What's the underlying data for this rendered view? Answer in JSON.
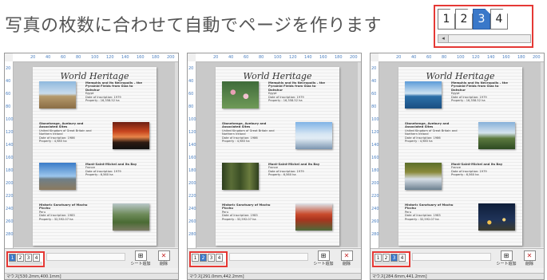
{
  "headline": "写真の枚数に合わせて自動でページを作ります",
  "zoom_tabs": [
    "1",
    "2",
    "3",
    "4"
  ],
  "zoom_selected": "3",
  "ruler_top": [
    "20",
    "40",
    "60",
    "80",
    "100",
    "120",
    "140",
    "160",
    "180",
    "200"
  ],
  "ruler_left": [
    "20",
    "40",
    "60",
    "80",
    "100",
    "120",
    "140",
    "160",
    "180",
    "200",
    "220",
    "240",
    "260",
    "280"
  ],
  "page_title": "World Heritage",
  "panels": [
    {
      "tabs": [
        "1",
        "2",
        "3",
        "4"
      ],
      "entries": [
        {
          "title": "Memphis and its Necropolis – the Pyramid Fields from Giza to Dahshur",
          "lines": [
            "Egypt",
            "Date of Inscription: 1979",
            "Property : 16,358.52 ha"
          ]
        },
        {
          "title": "Stonehenge, Avebury and Associated Sites",
          "lines": [
            "United Kingdom of Great Britain and Northern Ireland",
            "Date of Inscription: 1986",
            "Property : 4,985 ha"
          ]
        },
        {
          "title": "Mont-Saint-Michel and its Bay",
          "lines": [
            "France",
            "Date of Inscription: 1979",
            "Property : 6,560 ha"
          ]
        },
        {
          "title": "Historic Sanctuary of Machu Picchu",
          "lines": [
            "Peru",
            "Date of Inscription: 1983",
            "Property : 32,592.07 ha"
          ]
        }
      ],
      "btn_add": "シート追加",
      "btn_delete": "削除",
      "status": "マウス[530.2mm,400.1mm]"
    },
    {
      "tabs": [
        "1",
        "2",
        "3",
        "4"
      ],
      "entries": [
        {
          "title": "Memphis and its Necropolis – the Pyramid Fields from Giza to Dahshur",
          "lines": [
            "Egypt",
            "Date of Inscription: 1979",
            "Property : 16,358.52 ha"
          ]
        },
        {
          "title": "Stonehenge, Avebury and Associated Sites",
          "lines": [
            "United Kingdom of Great Britain and Northern Ireland",
            "Date of Inscription: 1986",
            "Property : 4,985 ha"
          ]
        },
        {
          "title": "Mont-Saint-Michel and its Bay",
          "lines": [
            "France",
            "Date of Inscription: 1979",
            "Property : 6,560 ha"
          ]
        },
        {
          "title": "Historic Sanctuary of Machu Picchu",
          "lines": [
            "Peru",
            "Date of Inscription: 1983",
            "Property : 32,592.07 ha"
          ]
        }
      ],
      "btn_add": "シート追加",
      "btn_delete": "削除",
      "status": "マウス[291.0mm,442.2mm]"
    },
    {
      "tabs": [
        "1",
        "2",
        "3",
        "4"
      ],
      "entries": [
        {
          "title": "Memphis and its Necropolis – the Pyramid Fields from Giza to Dahshur",
          "lines": [
            "Egypt",
            "Date of Inscription: 1979",
            "Property : 16,358.52 ha"
          ]
        },
        {
          "title": "Stonehenge, Avebury and Associated Sites",
          "lines": [
            "United Kingdom of Great Britain and Northern Ireland",
            "Date of Inscription: 1986",
            "Property : 4,985 ha"
          ]
        },
        {
          "title": "Mont-Saint-Michel and its Bay",
          "lines": [
            "France",
            "Date of Inscription: 1979",
            "Property : 6,560 ha"
          ]
        },
        {
          "title": "Historic Sanctuary of Machu Picchu",
          "lines": [
            "Peru",
            "Date of Inscription: 1983",
            "Property : 32,592.07 ha"
          ]
        }
      ],
      "btn_add": "シート追加",
      "btn_delete": "削除",
      "status": "マウス[284.6mm,441.2mm]"
    }
  ],
  "colors": {
    "accent": "#e53935",
    "tab_selected": "#3a78c9"
  }
}
